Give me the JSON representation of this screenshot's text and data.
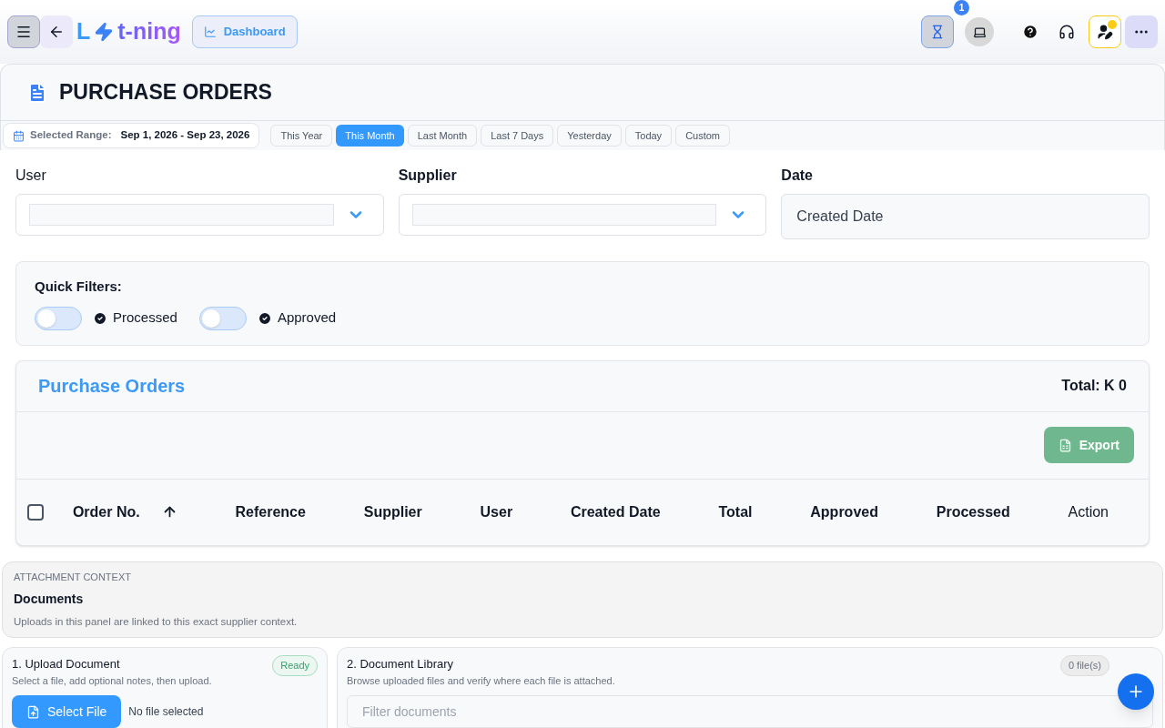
{
  "topbar": {
    "logo_parts": [
      "L",
      "t-ning"
    ],
    "dashboard_button": "Dashboard",
    "pending_badge": "1"
  },
  "page": {
    "title": "PURCHASE ORDERS"
  },
  "range": {
    "label": "Selected Range:",
    "value": "Sep 1, 2026 - Sep 23, 2026"
  },
  "range_presets": [
    {
      "label": "This Year",
      "selected": false
    },
    {
      "label": "This Month",
      "selected": true
    },
    {
      "label": "Last Month",
      "selected": false
    },
    {
      "label": "Last 7 Days",
      "selected": false
    },
    {
      "label": "Yesterday",
      "selected": false
    },
    {
      "label": "Today",
      "selected": false
    },
    {
      "label": "Custom",
      "selected": false
    }
  ],
  "filters": [
    {
      "kind": "select",
      "label": "User"
    },
    {
      "kind": "select",
      "label": "Supplier"
    },
    {
      "kind": "text",
      "label": "Date",
      "value": "Created Date"
    }
  ],
  "quick_filters": {
    "title": "Quick Filters:",
    "toggles": [
      {
        "label": "Processed",
        "on": false
      },
      {
        "label": "Approved",
        "on": false
      }
    ]
  },
  "orders_table": {
    "title": "Purchase Orders",
    "total": "Total: K 0",
    "export_button": "Export",
    "select_all_checked": false,
    "columns": [
      "Order No.",
      "Reference",
      "Supplier",
      "User",
      "Created Date",
      "Total",
      "Approved",
      "Processed",
      "Action"
    ]
  },
  "attachment": {
    "eyebrow": "ATTACHMENT CONTEXT",
    "title": "Documents",
    "description": "Uploads in this panel are linked to this exact supplier context."
  },
  "upload": {
    "title": "1. Upload Document",
    "subtitle": "Select a file, add optional notes, then upload.",
    "status": "Ready",
    "select_button": "Select File",
    "file_status": "No file selected"
  },
  "library": {
    "title": "2. Document Library",
    "subtitle": "Browse uploaded files and verify where each file is attached.",
    "count": "0 file(s)",
    "filter_placeholder": "Filter documents"
  }
}
